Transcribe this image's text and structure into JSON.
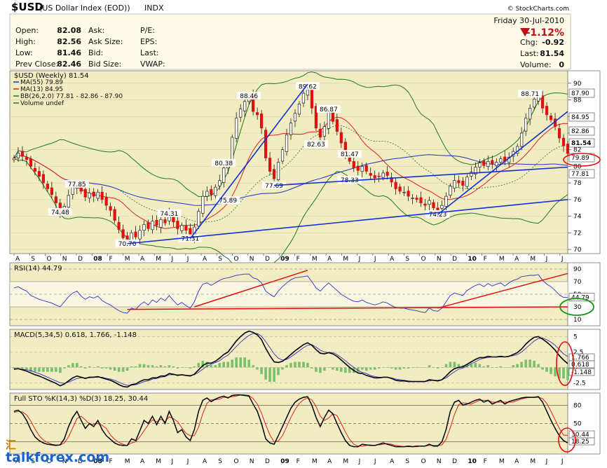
{
  "header": {
    "symbol": "$USD",
    "name": "(US Dollar Index (EOD))",
    "exchange": "INDX",
    "source": "© StockCharts.com",
    "date": "Friday  30-Jul-2010",
    "pct_change": "-1.12%",
    "quote": [
      {
        "label": "Open:",
        "value": "82.08"
      },
      {
        "label": "High:",
        "value": "82.56"
      },
      {
        "label": "Low:",
        "value": "81.46"
      },
      {
        "label": "Prev Close:",
        "value": "82.46"
      }
    ],
    "ask_labels": [
      "Ask:",
      "Ask Size:",
      "Bid:",
      "Bid Size:"
    ],
    "ratio_labels": [
      "P/E:",
      "EPS:",
      "Last:",
      "VWAP:"
    ],
    "right": [
      {
        "label": "Chg:",
        "value": "-0.92"
      },
      {
        "label": "Last:",
        "value": "81.54"
      },
      {
        "label": "Volume:",
        "value": "0"
      }
    ]
  },
  "colors": {
    "up": "#1aa51a",
    "down": "#e01010",
    "panel_bg": "#f2ecc2",
    "header_bg": "#fffbe8",
    "ma55": "#2030c0",
    "ma13": "#e02020",
    "bb": "#207a20",
    "trend": "#1030d0",
    "circle_red": "#e01010",
    "circle_green": "#119911"
  },
  "chart_data": {
    "price_panel": {
      "type": "candlestick",
      "title": "$USD (Weekly) 81.54",
      "legend": [
        "MA(55) 79.89",
        "MA(13) 84.95",
        "BB(26,2.0) 77.81 - 82.86 - 87.90",
        "Volume undef"
      ],
      "y_ticks": [
        70,
        72,
        74,
        76,
        78,
        80,
        82,
        84,
        86,
        88,
        90
      ],
      "ylim": [
        69.5,
        91.5
      ],
      "last_value_boxes": [
        "87.90",
        "84.95",
        "82.86",
        "81.54",
        "79.89",
        "77.81"
      ],
      "annotations": [
        {
          "text": "77.85",
          "idx": 15,
          "value": 77.85
        },
        {
          "text": "74.48",
          "idx": 11,
          "value": 74.48
        },
        {
          "text": "70.70",
          "idx": 27,
          "value": 70.7
        },
        {
          "text": "74.31",
          "idx": 37,
          "value": 74.31
        },
        {
          "text": "71.31",
          "idx": 42,
          "value": 71.31
        },
        {
          "text": "75.89",
          "idx": 51,
          "value": 75.89
        },
        {
          "text": "80.38",
          "idx": 50,
          "value": 80.38
        },
        {
          "text": "88.46",
          "idx": 56,
          "value": 88.46
        },
        {
          "text": "77.69",
          "idx": 62,
          "value": 77.69
        },
        {
          "text": "89.62",
          "idx": 70,
          "value": 89.62
        },
        {
          "text": "82.63",
          "idx": 72,
          "value": 82.63
        },
        {
          "text": "86.87",
          "idx": 75,
          "value": 86.87
        },
        {
          "text": "81.47",
          "idx": 80,
          "value": 81.47
        },
        {
          "text": "78.33",
          "idx": 80,
          "value": 78.33
        },
        {
          "text": "74.23",
          "idx": 101,
          "value": 74.23
        },
        {
          "text": "88.71",
          "idx": 123,
          "value": 88.71
        }
      ],
      "close": [
        81.0,
        81.6,
        81.2,
        80.8,
        80.0,
        79.4,
        78.8,
        78.0,
        77.3,
        76.6,
        75.6,
        74.5,
        75.2,
        76.5,
        77.6,
        77.85,
        77.0,
        76.3,
        76.8,
        76.4,
        76.9,
        76.0,
        75.3,
        74.7,
        73.5,
        72.4,
        71.4,
        71.0,
        72.0,
        71.5,
        72.3,
        73.0,
        72.5,
        73.4,
        72.9,
        73.6,
        73.2,
        74.3,
        73.3,
        72.5,
        72.9,
        72.3,
        71.6,
        72.7,
        74.6,
        76.4,
        77.0,
        76.6,
        77.5,
        78.3,
        79.8,
        80.4,
        83.5,
        85.8,
        86.9,
        87.8,
        88.3,
        86.6,
        86.2,
        84.6,
        81.0,
        79.4,
        78.5,
        80.5,
        82.0,
        83.8,
        85.2,
        86.4,
        87.5,
        88.8,
        89.2,
        87.0,
        84.6,
        83.5,
        84.8,
        86.6,
        85.4,
        84.2,
        82.8,
        81.6,
        80.6,
        79.8,
        79.5,
        80.0,
        79.4,
        78.9,
        78.6,
        78.8,
        79.2,
        78.9,
        78.1,
        77.3,
        77.0,
        76.9,
        76.4,
        76.2,
        76.0,
        75.6,
        75.3,
        75.9,
        75.0,
        74.7,
        75.3,
        76.4,
        77.6,
        78.3,
        78.0,
        77.7,
        78.7,
        79.3,
        79.9,
        80.4,
        80.1,
        80.6,
        80.3,
        80.5,
        80.9,
        80.6,
        81.1,
        81.8,
        82.4,
        84.0,
        85.8,
        87.0,
        88.1,
        88.5,
        87.0,
        86.2,
        85.6,
        84.8,
        83.4,
        82.46,
        81.54
      ],
      "x_axis_labels": [
        "A",
        "S",
        "O",
        "N",
        "D",
        "08",
        "F",
        "M",
        "A",
        "M",
        "J",
        "J",
        "A",
        "S",
        "O",
        "N",
        "D",
        "09",
        "F",
        "M",
        "A",
        "M",
        "J",
        "J",
        "A",
        "S",
        "O",
        "N",
        "D",
        "10",
        "F",
        "M",
        "A",
        "M",
        "J",
        "J"
      ]
    },
    "rsi_panel": {
      "type": "line",
      "title": "RSI(14) 44.79",
      "y_ticks": [
        10,
        30,
        50,
        70,
        90
      ],
      "ylim": [
        0,
        100
      ],
      "last_value_box": "44.79",
      "values": [
        60,
        62,
        58,
        55,
        48,
        45,
        42,
        40,
        38,
        36,
        33,
        30,
        38,
        46,
        52,
        55,
        47,
        42,
        46,
        44,
        47,
        40,
        36,
        33,
        28,
        24,
        21,
        20,
        28,
        26,
        33,
        38,
        33,
        41,
        37,
        44,
        40,
        48,
        40,
        33,
        37,
        32,
        28,
        38,
        55,
        66,
        68,
        64,
        68,
        72,
        75,
        76,
        78,
        80,
        81,
        82,
        82,
        76,
        74,
        68,
        55,
        50,
        46,
        55,
        62,
        68,
        73,
        76,
        77,
        78,
        79,
        70,
        60,
        55,
        62,
        68,
        62,
        56,
        50,
        46,
        42,
        39,
        38,
        41,
        37,
        35,
        33,
        35,
        38,
        36,
        32,
        29,
        28,
        28,
        26,
        25,
        24,
        22,
        21,
        28,
        24,
        23,
        28,
        38,
        48,
        52,
        50,
        48,
        56,
        60,
        64,
        66,
        62,
        67,
        63,
        66,
        68,
        63,
        68,
        72,
        74,
        78,
        79,
        80,
        80,
        81,
        72,
        66,
        62,
        56,
        49,
        45,
        44.79
      ]
    },
    "macd_panel": {
      "type": "line",
      "title": "MACD(5,34,5) 0.618, 1.766, -1.148",
      "y_ticks": [
        -2.5,
        0.0,
        2.5,
        5.0
      ],
      "ylim": [
        -3.6,
        6.2
      ],
      "last_value_boxes": [
        "1.766",
        "0.618",
        "-1.148"
      ],
      "macd": [
        -0.3,
        -0.2,
        -0.4,
        -0.6,
        -0.9,
        -1.2,
        -1.4,
        -1.7,
        -2.0,
        -2.3,
        -2.6,
        -3.0,
        -2.7,
        -2.2,
        -1.7,
        -1.4,
        -1.6,
        -1.8,
        -1.6,
        -1.6,
        -1.5,
        -1.7,
        -1.9,
        -2.1,
        -2.4,
        -2.8,
        -3.1,
        -3.2,
        -2.8,
        -2.7,
        -2.3,
        -2.0,
        -2.0,
        -1.7,
        -1.7,
        -1.4,
        -1.4,
        -1.0,
        -1.1,
        -1.3,
        -1.2,
        -1.3,
        -1.4,
        -1.1,
        -0.4,
        0.3,
        0.7,
        0.7,
        1.0,
        1.5,
        2.1,
        2.5,
        3.4,
        4.3,
        5.0,
        5.6,
        5.9,
        5.7,
        5.3,
        4.5,
        3.1,
        1.9,
        0.9,
        0.8,
        1.0,
        1.5,
        2.1,
        2.7,
        3.2,
        3.7,
        4.0,
        3.6,
        2.9,
        2.3,
        2.2,
        2.4,
        2.2,
        1.8,
        1.2,
        0.6,
        0.0,
        -0.5,
        -0.9,
        -1.0,
        -1.3,
        -1.5,
        -1.7,
        -1.7,
        -1.6,
        -1.6,
        -1.8,
        -2.1,
        -2.2,
        -2.2,
        -2.3,
        -2.3,
        -2.3,
        -2.3,
        -2.3,
        -2.0,
        -2.1,
        -2.2,
        -2.0,
        -1.4,
        -0.7,
        -0.2,
        0.0,
        0.1,
        0.5,
        0.9,
        1.3,
        1.6,
        1.6,
        1.8,
        1.7,
        1.7,
        1.8,
        1.7,
        1.8,
        2.1,
        2.4,
        3.0,
        3.8,
        4.4,
        4.9,
        5.0,
        4.6,
        4.1,
        3.5,
        2.8,
        1.9,
        1.2,
        0.618
      ],
      "signal": [
        -0.2,
        -0.2,
        -0.3,
        -0.4,
        -0.5,
        -0.8,
        -1.0,
        -1.3,
        -1.6,
        -1.9,
        -2.2,
        -2.5,
        -2.6,
        -2.4,
        -2.1,
        -1.8,
        -1.7,
        -1.7,
        -1.7,
        -1.6,
        -1.6,
        -1.6,
        -1.8,
        -1.9,
        -2.1,
        -2.4,
        -2.7,
        -2.9,
        -2.9,
        -2.8,
        -2.6,
        -2.3,
        -2.2,
        -1.9,
        -1.8,
        -1.6,
        -1.5,
        -1.2,
        -1.2,
        -1.2,
        -1.2,
        -1.3,
        -1.3,
        -1.2,
        -0.8,
        -0.3,
        0.2,
        0.5,
        0.8,
        1.1,
        1.6,
        2.0,
        2.7,
        3.4,
        4.1,
        4.7,
        5.2,
        5.5,
        5.5,
        5.1,
        4.2,
        3.2,
        2.2,
        1.5,
        1.2,
        1.3,
        1.7,
        2.2,
        2.7,
        3.2,
        3.6,
        3.7,
        3.3,
        2.8,
        2.5,
        2.4,
        2.4,
        2.1,
        1.6,
        1.1,
        0.5,
        0.0,
        -0.5,
        -0.8,
        -1.0,
        -1.3,
        -1.5,
        -1.6,
        -1.6,
        -1.6,
        -1.7,
        -1.9,
        -2.0,
        -2.1,
        -2.2,
        -2.3,
        -2.3,
        -2.3,
        -2.3,
        -2.2,
        -2.1,
        -2.1,
        -2.0,
        -1.7,
        -1.2,
        -0.7,
        -0.3,
        -0.1,
        0.2,
        0.6,
        0.9,
        1.3,
        1.5,
        1.6,
        1.7,
        1.7,
        1.7,
        1.7,
        1.8,
        1.9,
        2.1,
        2.5,
        3.1,
        3.7,
        4.3,
        4.7,
        4.8,
        4.5,
        4.1,
        3.6,
        2.9,
        2.2,
        1.766
      ]
    },
    "sto_panel": {
      "type": "line",
      "title": "Full STO %K(14,3) %D(3) 18.25, 30.44",
      "y_ticks": [
        20,
        50,
        80
      ],
      "ylim": [
        0,
        100
      ],
      "last_value_boxes": [
        "30.44",
        "18.25"
      ],
      "k": [
        70,
        72,
        66,
        55,
        40,
        28,
        22,
        18,
        16,
        15,
        14,
        15,
        25,
        45,
        60,
        70,
        55,
        42,
        50,
        45,
        55,
        40,
        30,
        24,
        18,
        15,
        14,
        14,
        25,
        22,
        38,
        55,
        50,
        62,
        48,
        62,
        50,
        70,
        55,
        35,
        40,
        28,
        22,
        40,
        70,
        88,
        92,
        86,
        90,
        93,
        95,
        92,
        96,
        97,
        97,
        96,
        95,
        82,
        70,
        50,
        25,
        18,
        16,
        30,
        45,
        60,
        75,
        85,
        90,
        93,
        94,
        80,
        60,
        45,
        60,
        72,
        66,
        50,
        35,
        22,
        14,
        12,
        12,
        16,
        15,
        14,
        14,
        16,
        18,
        16,
        14,
        12,
        12,
        12,
        13,
        12,
        13,
        13,
        13,
        16,
        13,
        13,
        20,
        40,
        70,
        85,
        88,
        80,
        82,
        85,
        88,
        90,
        85,
        88,
        82,
        85,
        88,
        82,
        86,
        88,
        90,
        92,
        93,
        93,
        93,
        94,
        85,
        70,
        55,
        42,
        30,
        22,
        18.25
      ],
      "d": [
        68,
        70,
        69,
        64,
        54,
        41,
        30,
        23,
        19,
        16,
        15,
        15,
        18,
        28,
        43,
        58,
        62,
        56,
        49,
        49,
        50,
        47,
        42,
        31,
        24,
        19,
        16,
        14,
        18,
        20,
        28,
        38,
        48,
        56,
        53,
        57,
        53,
        61,
        58,
        53,
        43,
        34,
        30,
        30,
        44,
        66,
        83,
        89,
        89,
        90,
        93,
        93,
        94,
        95,
        97,
        97,
        96,
        91,
        82,
        67,
        48,
        31,
        20,
        21,
        30,
        45,
        60,
        73,
        83,
        89,
        92,
        89,
        78,
        62,
        55,
        59,
        66,
        63,
        50,
        36,
        24,
        16,
        13,
        13,
        14,
        15,
        14,
        15,
        16,
        17,
        16,
        14,
        13,
        12,
        12,
        12,
        12,
        13,
        13,
        14,
        14,
        14,
        15,
        24,
        43,
        65,
        81,
        84,
        83,
        82,
        85,
        88,
        88,
        88,
        85,
        85,
        85,
        85,
        85,
        85,
        88,
        90,
        92,
        93,
        93,
        93,
        91,
        83,
        70,
        56,
        42,
        31,
        30.44
      ]
    }
  }
}
